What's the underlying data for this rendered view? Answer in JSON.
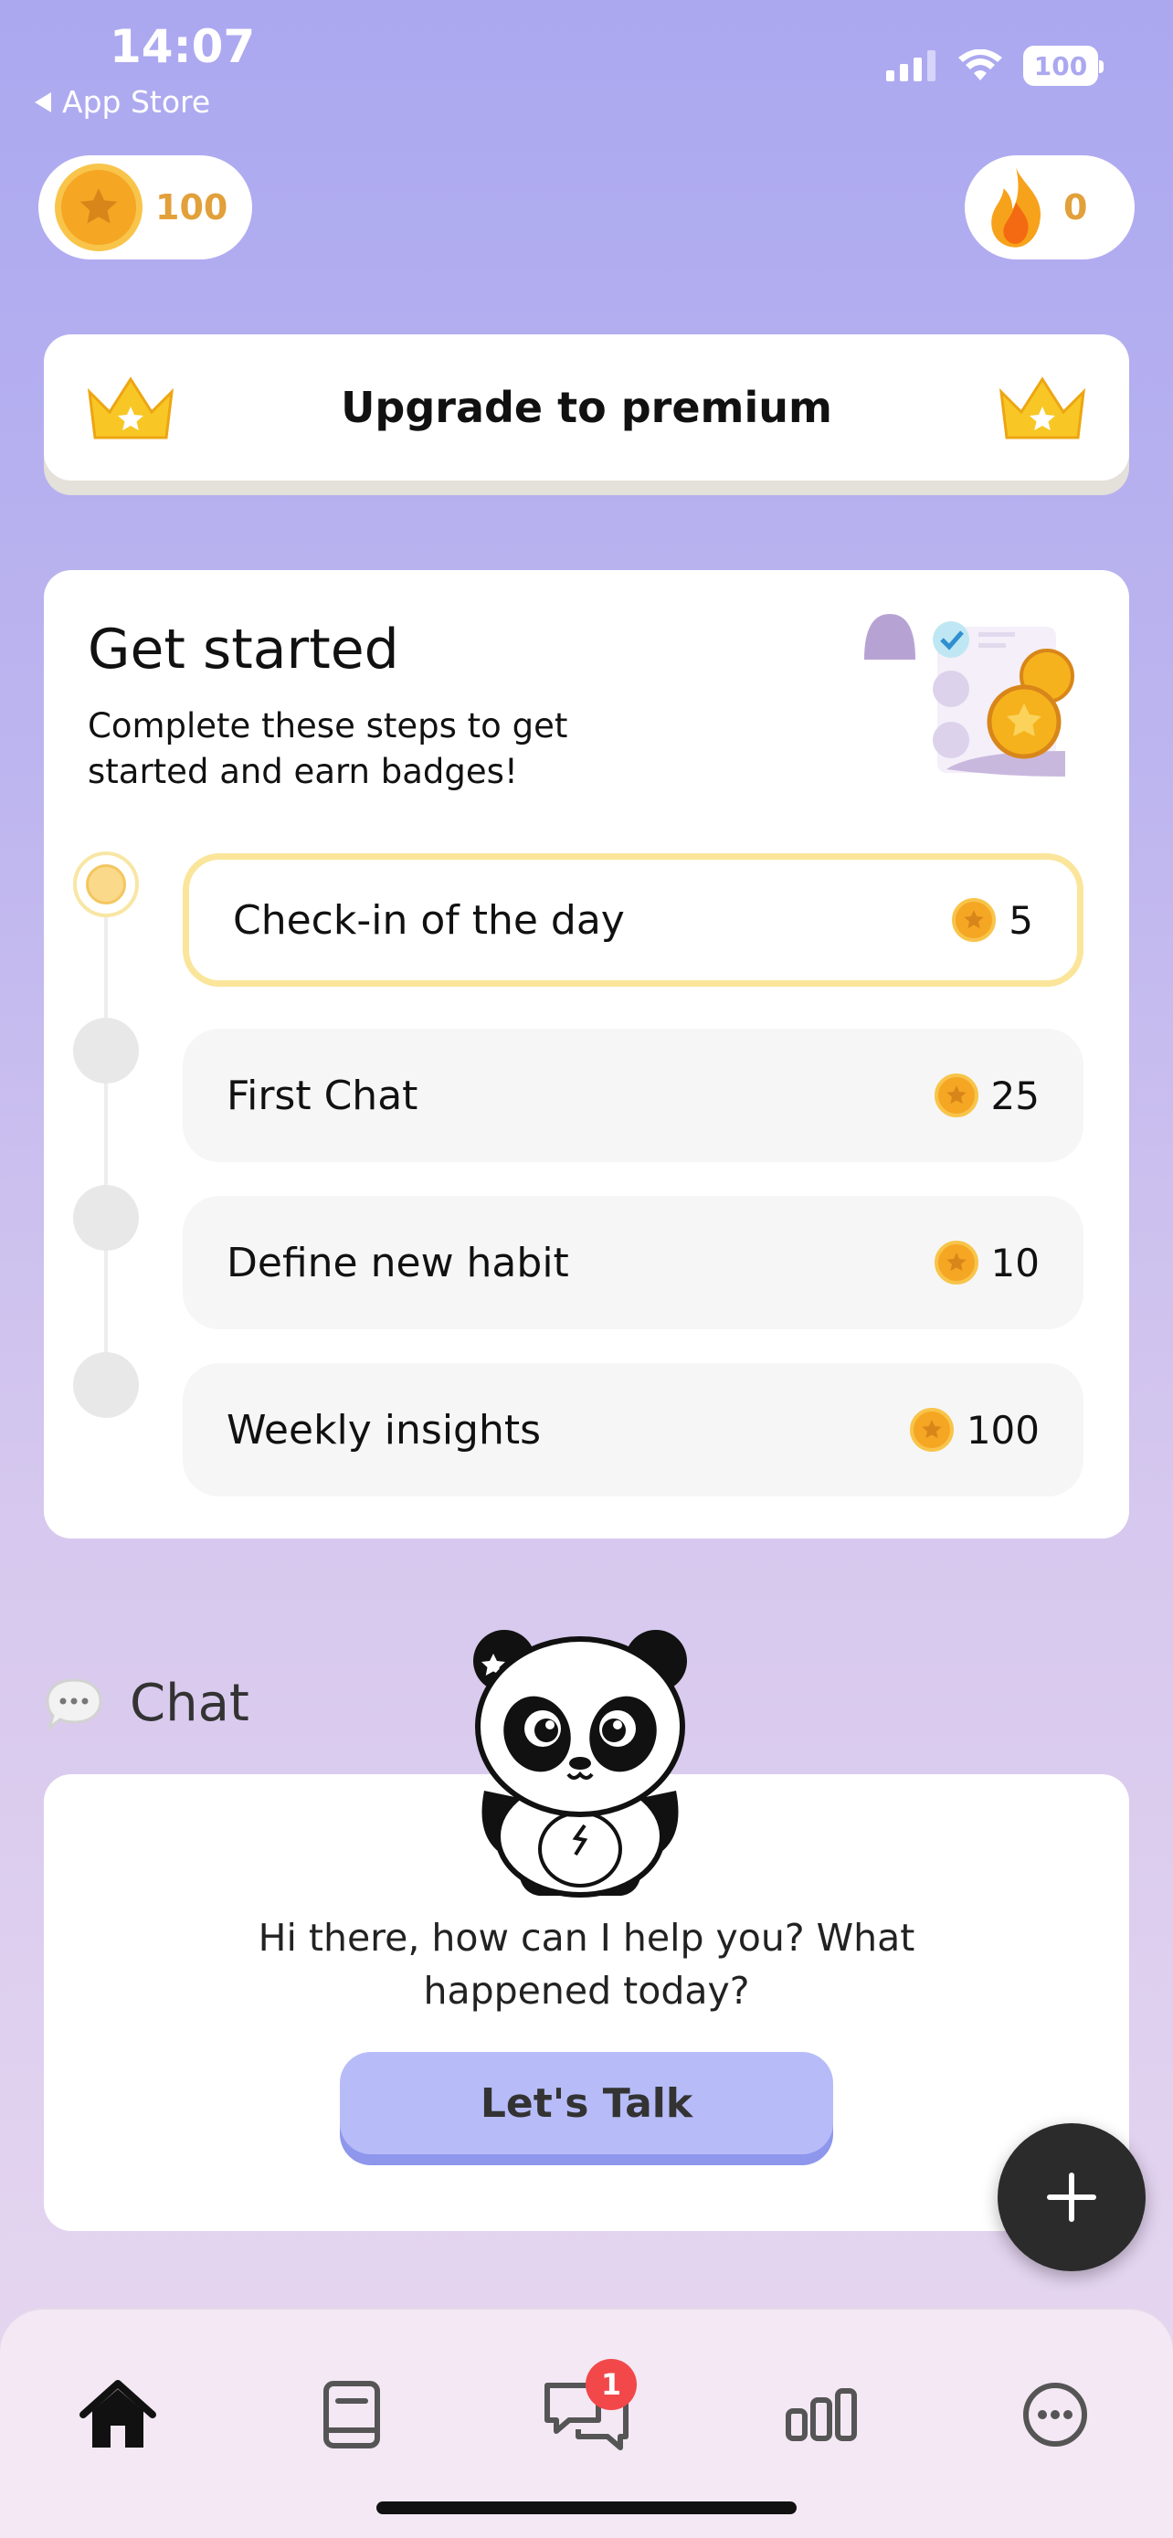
{
  "status_bar": {
    "time": "14:07",
    "back_label": "App Store",
    "battery": "100"
  },
  "counters": {
    "coins": "100",
    "streak": "0"
  },
  "upgrade": {
    "label": "Upgrade to premium"
  },
  "get_started": {
    "title": "Get started",
    "subtitle": "Complete these steps to get started and earn badges!",
    "steps": [
      {
        "label": "Check-in of the day",
        "reward": "5"
      },
      {
        "label": "First Chat",
        "reward": "25"
      },
      {
        "label": "Define new habit",
        "reward": "10"
      },
      {
        "label": "Weekly insights",
        "reward": "100"
      }
    ]
  },
  "chat": {
    "section_title": "Chat",
    "message": "Hi there, how can I help you? What happened today?",
    "button_label": "Let's Talk"
  },
  "tabbar": {
    "items": [
      "home-icon",
      "journal-icon",
      "chat-icon",
      "stats-icon",
      "more-icon"
    ],
    "chat_badge": "1"
  },
  "colors": {
    "accent": "#B7BCF8",
    "coin": "#F5A623",
    "badge": "#F2484A"
  }
}
